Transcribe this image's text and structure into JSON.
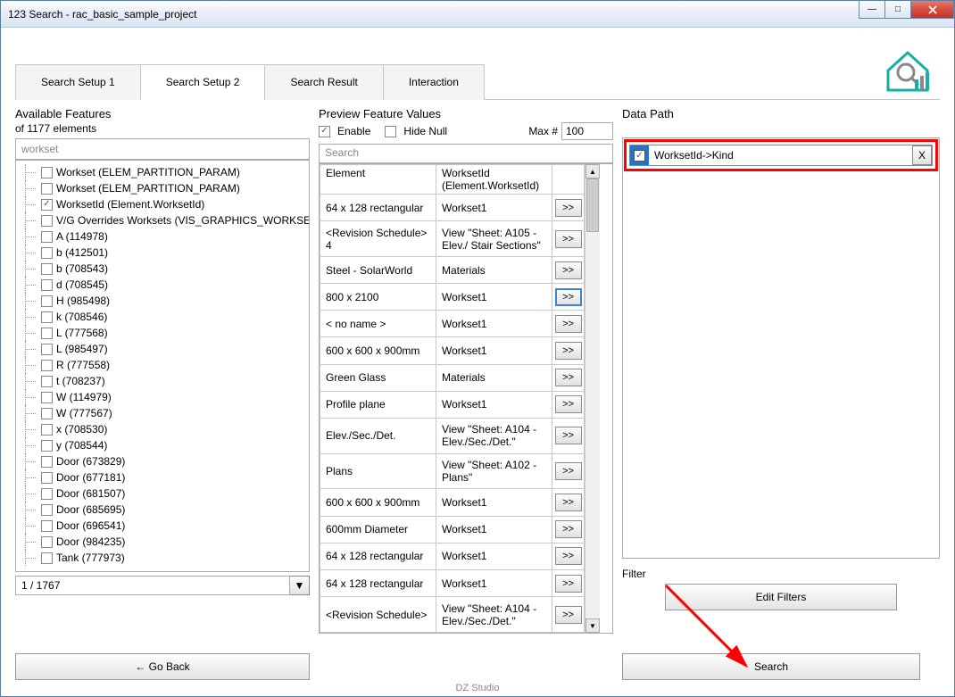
{
  "window": {
    "title": "123 Search - rac_basic_sample_project"
  },
  "tabs": [
    "Search Setup 1",
    "Search Setup 2",
    "Search Result",
    "Interaction"
  ],
  "activeTab": 1,
  "left": {
    "heading": "Available Features",
    "sub": "of 1177 elements",
    "filter": "workset",
    "items": [
      {
        "label": "Workset (ELEM_PARTITION_PARAM)",
        "checked": false
      },
      {
        "label": "Workset (ELEM_PARTITION_PARAM)",
        "checked": false
      },
      {
        "label": "WorksetId (Element.WorksetId)",
        "checked": true
      },
      {
        "label": "V/G Overrides Worksets (VIS_GRAPHICS_WORKSETS)",
        "checked": false
      },
      {
        "label": "A (114978)",
        "checked": false
      },
      {
        "label": "b (412501)",
        "checked": false
      },
      {
        "label": "b (708543)",
        "checked": false
      },
      {
        "label": "d (708545)",
        "checked": false
      },
      {
        "label": "H (985498)",
        "checked": false
      },
      {
        "label": "k (708546)",
        "checked": false
      },
      {
        "label": "L (777568)",
        "checked": false
      },
      {
        "label": "L (985497)",
        "checked": false
      },
      {
        "label": "R (777558)",
        "checked": false
      },
      {
        "label": "t (708237)",
        "checked": false
      },
      {
        "label": "W (114979)",
        "checked": false
      },
      {
        "label": "W (777567)",
        "checked": false
      },
      {
        "label": "x (708530)",
        "checked": false
      },
      {
        "label": "y (708544)",
        "checked": false
      },
      {
        "label": "Door (673829)",
        "checked": false
      },
      {
        "label": "Door (677181)",
        "checked": false
      },
      {
        "label": "Door (681507)",
        "checked": false
      },
      {
        "label": "Door (685695)",
        "checked": false
      },
      {
        "label": "Door (696541)",
        "checked": false
      },
      {
        "label": "Door (984235)",
        "checked": false
      },
      {
        "label": "Tank (777973)",
        "checked": false
      }
    ],
    "pager": "1 / 1767",
    "goBack": "← Go Back"
  },
  "mid": {
    "heading": "Preview Feature Values",
    "enable": "Enable",
    "hideNull": "Hide Null",
    "maxLabel": "Max #",
    "maxVal": "100",
    "search": "Search",
    "col1": "Element",
    "col2a": "WorksetId",
    "col2b": "(Element.WorksetId)",
    "rows": [
      {
        "el": "64 x 128 rectangular",
        "val": "Workset1",
        "sel": false
      },
      {
        "el": "<Revision Schedule> 4",
        "val": "View \"Sheet: A105 - Elev./ Stair Sections\"",
        "sel": false
      },
      {
        "el": "Steel - SolarWorld",
        "val": "Materials",
        "sel": false
      },
      {
        "el": "800 x 2100",
        "val": "Workset1",
        "sel": true
      },
      {
        "el": "< no name >",
        "val": "Workset1",
        "sel": false
      },
      {
        "el": "600 x 600 x 900mm",
        "val": "Workset1",
        "sel": false
      },
      {
        "el": "Green Glass",
        "val": "Materials",
        "sel": false
      },
      {
        "el": "Profile plane",
        "val": "Workset1",
        "sel": false
      },
      {
        "el": "Elev./Sec./Det.",
        "val": "View \"Sheet: A104 - Elev./Sec./Det.\"",
        "sel": false
      },
      {
        "el": "Plans",
        "val": "View \"Sheet: A102 - Plans\"",
        "sel": false
      },
      {
        "el": "600 x 600 x 900mm",
        "val": "Workset1",
        "sel": false
      },
      {
        "el": "600mm Diameter",
        "val": "Workset1",
        "sel": false
      },
      {
        "el": "64 x 128 rectangular",
        "val": "Workset1",
        "sel": false
      },
      {
        "el": "64 x 128 rectangular",
        "val": "Workset1",
        "sel": false
      },
      {
        "el": "<Revision Schedule>",
        "val": "View \"Sheet: A104 - Elev./Sec./Det.\"",
        "sel": false
      }
    ],
    "expand": ">>"
  },
  "right": {
    "heading": "Data Path",
    "path": "WorksetId->Kind",
    "x": "X",
    "filter": "Filter",
    "editFilters": "Edit Filters",
    "search": "Search"
  },
  "footer": "DZ Studio"
}
